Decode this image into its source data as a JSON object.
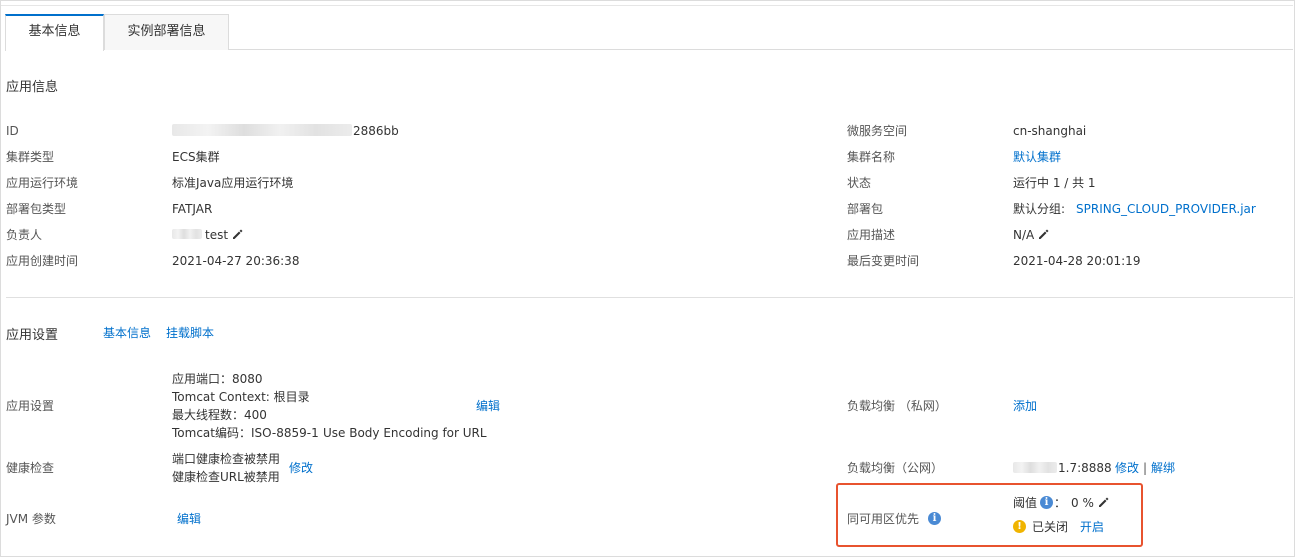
{
  "tabs": [
    {
      "label": "基本信息",
      "active": true
    },
    {
      "label": "实例部署信息",
      "active": false
    }
  ],
  "app_info": {
    "title": "应用信息",
    "left": [
      {
        "label": "ID",
        "value": "2886bb"
      },
      {
        "label": "集群类型",
        "value": "ECS集群"
      },
      {
        "label": "应用运行环境",
        "value": "标准Java应用运行环境"
      },
      {
        "label": "部署包类型",
        "value": "FATJAR"
      },
      {
        "label": "负责人",
        "value": "test"
      },
      {
        "label": "应用创建时间",
        "value": "2021-04-27 20:36:38"
      }
    ],
    "right": [
      {
        "label": "微服务空间",
        "value": "cn-shanghai"
      },
      {
        "label": "集群名称",
        "value": "默认集群"
      },
      {
        "label": "状态",
        "value": "运行中 1 / 共 1"
      },
      {
        "label": "部署包",
        "prefix": "默认分组:",
        "value": "SPRING_CLOUD_PROVIDER.jar"
      },
      {
        "label": "应用描述",
        "value": "N/A"
      },
      {
        "label": "最后变更时间",
        "value": "2021-04-28 20:01:19"
      }
    ]
  },
  "app_settings": {
    "title": "应用设置",
    "header_links": [
      "基本信息",
      "挂载脚本"
    ],
    "settings_row": {
      "label": "应用设置",
      "lines": [
        "应用端口：8080",
        "Tomcat Context: 根目录",
        "最大线程数：400",
        "Tomcat编码：ISO-8859-1",
        "Use Body Encoding for URL"
      ],
      "action": "编辑"
    },
    "health_row": {
      "label": "健康检查",
      "lines": [
        "端口健康检查被禁用",
        "健康检查URL被禁用"
      ],
      "action": "修改"
    },
    "jvm_row": {
      "label": "JVM 参数",
      "action": "编辑"
    },
    "lb_private": {
      "label": "负载均衡 （私网）",
      "action": "添加"
    },
    "lb_public": {
      "label": "负载均衡（公网）",
      "value": "1.7:8888",
      "action_modify": "修改",
      "separator": "|",
      "action_unbind": "解绑"
    },
    "same_zone": {
      "label": "同可用区优先",
      "threshold_label": "阈值",
      "threshold_colon": "：",
      "threshold_value": "0 %",
      "status": "已关闭",
      "action": "开启"
    }
  },
  "colors": {
    "link": "#0070cc",
    "accent_tab": "#0070cc",
    "highlight": "#e8532f",
    "info": "#4a8ad4",
    "warn": "#f0b400"
  }
}
